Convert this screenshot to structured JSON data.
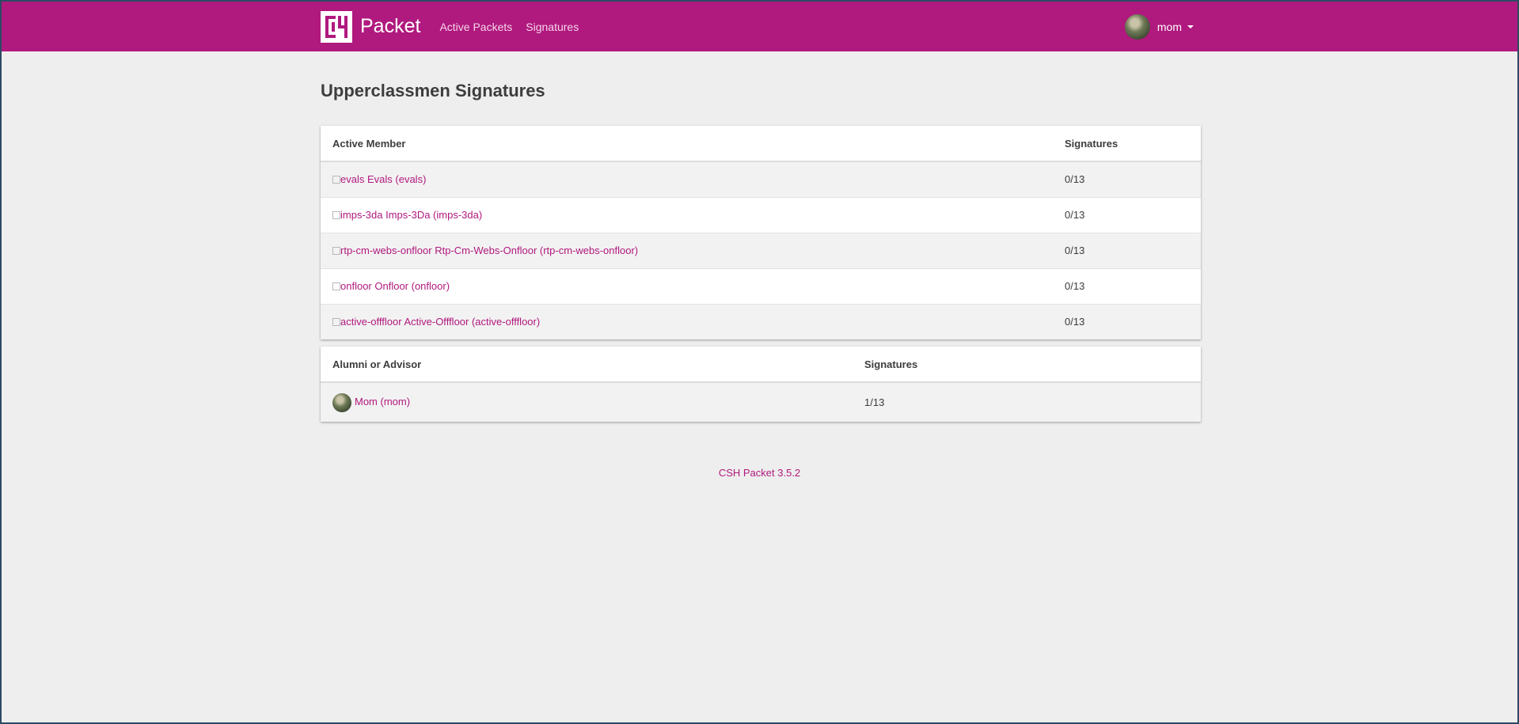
{
  "navbar": {
    "brand": "Packet",
    "links": [
      "Active Packets",
      "Signatures"
    ],
    "user": "mom"
  },
  "page": {
    "title": "Upperclassmen Signatures"
  },
  "active_table": {
    "headers": [
      "Active Member",
      "Signatures"
    ],
    "rows": [
      {
        "img_alt": "evals",
        "name": "Evals (evals)",
        "sigs": "0/13"
      },
      {
        "img_alt": "imps-3da",
        "name": "Imps-3Da (imps-3da)",
        "sigs": "0/13"
      },
      {
        "img_alt": "rtp-cm-webs-onfloor",
        "name": "Rtp-Cm-Webs-Onfloor (rtp-cm-webs-onfloor)",
        "sigs": "0/13"
      },
      {
        "img_alt": "onfloor",
        "name": "Onfloor (onfloor)",
        "sigs": "0/13"
      },
      {
        "img_alt": "active-offfloor",
        "name": "Active-Offfloor (active-offfloor)",
        "sigs": "0/13"
      }
    ]
  },
  "alumni_table": {
    "headers": [
      "Alumni or Advisor",
      "Signatures"
    ],
    "rows": [
      {
        "name": "Mom (mom)",
        "sigs": "1/13"
      }
    ]
  },
  "footer": {
    "text": "CSH Packet 3.5.2"
  },
  "colors": {
    "accent": "#b0197e",
    "background": "#eeeeee"
  }
}
